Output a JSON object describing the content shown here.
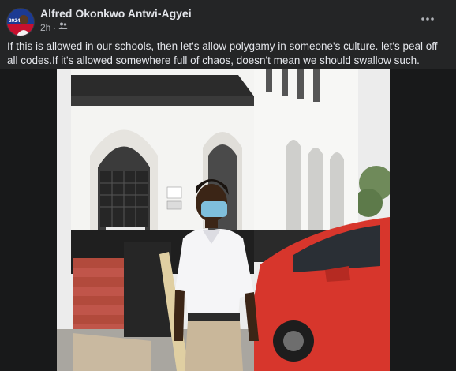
{
  "post": {
    "author_name": "Alfred Okonkwo Antwi-Agyei",
    "time": "2h",
    "audience_icon": "friends-icon",
    "separator": "·",
    "caption": "If this is allowed in our schools, then let's allow polygamy in someone's culture. let's peal off all codes.If it's allowed somewhere full of chaos, doesn't mean we should swallow such.",
    "more_icon": "more-options-icon"
  },
  "avatar": {
    "badge_text": "2024"
  },
  "colors": {
    "background": "#242526",
    "text_primary": "#e4e6eb",
    "text_secondary": "#b0b3b8",
    "media_background": "#18191a"
  }
}
